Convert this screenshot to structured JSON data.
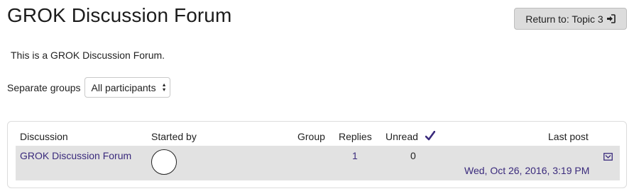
{
  "page": {
    "title": "GROK Discussion Forum",
    "return_button": "Return to: Topic 3",
    "intro": "This is a GROK Discussion Forum."
  },
  "groups": {
    "label": "Separate groups",
    "selected": "All participants"
  },
  "table": {
    "headers": {
      "discussion": "Discussion",
      "started_by": "Started by",
      "group": "Group",
      "replies": "Replies",
      "unread": "Unread",
      "last_post": "Last post"
    },
    "rows": [
      {
        "discussion": "GROK Discussion Forum",
        "started_by": "",
        "group": "",
        "replies": "1",
        "unread": "0",
        "last_post": "Wed, Oct 26, 2016, 3:19 PM"
      }
    ]
  },
  "colors": {
    "link": "#3a2a7c",
    "row_bg": "#e2e2e2",
    "button_bg": "#dcdcdc"
  },
  "icons": {
    "return": "sign-in-icon",
    "unread": "check-icon",
    "subscribe": "envelope-icon",
    "select": "sort-arrows-icon"
  }
}
